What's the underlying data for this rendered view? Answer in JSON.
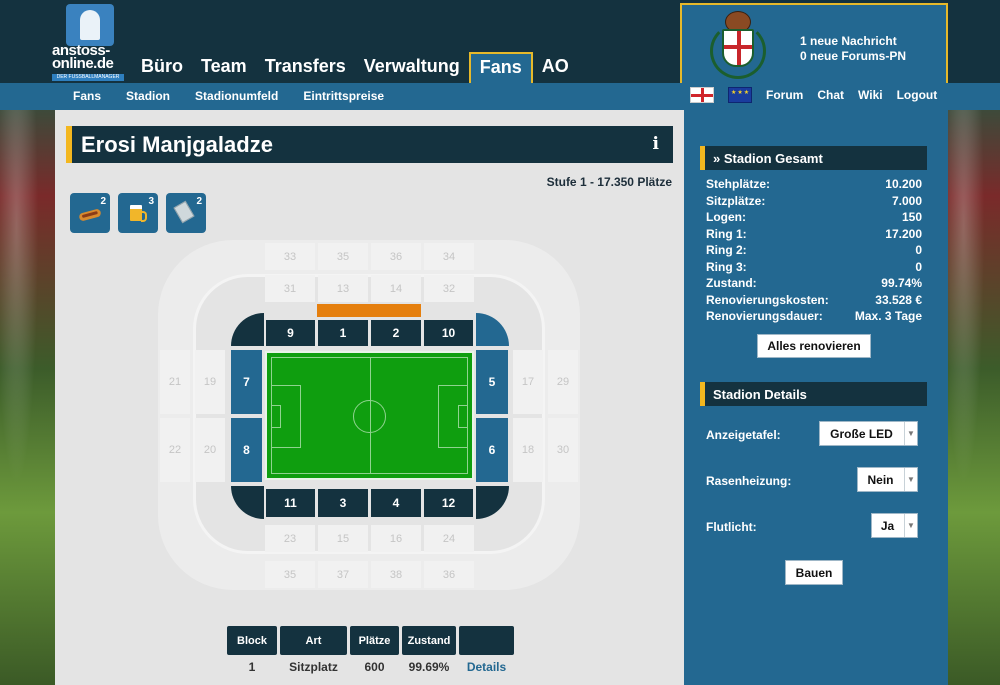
{
  "logo": {
    "text": "anstoss-online.de",
    "line1": "anstoss-",
    "line2": "online.de",
    "tagline": "DER FUSSBALLMANAGER"
  },
  "main_nav": [
    {
      "label": "Büro",
      "active": false
    },
    {
      "label": "Team",
      "active": false
    },
    {
      "label": "Transfers",
      "active": false
    },
    {
      "label": "Verwaltung",
      "active": false
    },
    {
      "label": "Fans",
      "active": true
    },
    {
      "label": "AO",
      "active": false
    }
  ],
  "user": {
    "messages": "1 neue Nachricht",
    "forum_pm": "0 neue Forums-PN"
  },
  "sub_nav": [
    "Fans",
    "Stadion",
    "Stadionumfeld",
    "Eintrittspreise"
  ],
  "right_nav": [
    "Forum",
    "Chat",
    "Wiki",
    "Logout"
  ],
  "page": {
    "title": "Erosi Manjgaladze",
    "info_icon": "i",
    "stufe": "Stufe 1 - 17.350 Plätze"
  },
  "items": [
    {
      "icon": "hotdog-icon",
      "count": "2"
    },
    {
      "icon": "beer-icon",
      "count": "3"
    },
    {
      "icon": "scarf-icon",
      "count": "2"
    }
  ],
  "stadium": {
    "blocks": [
      "9",
      "1",
      "2",
      "10",
      "7",
      "8",
      "5",
      "6",
      "11",
      "3",
      "4",
      "12"
    ],
    "ghost_blocks": [
      "33",
      "35",
      "36",
      "34",
      "31",
      "13",
      "14",
      "32",
      "21",
      "19",
      "22",
      "20",
      "17",
      "29",
      "18",
      "30",
      "23",
      "15",
      "16",
      "24",
      "35",
      "37",
      "38",
      "36"
    ]
  },
  "table": {
    "headers": [
      "Block",
      "Art",
      "Plätze",
      "Zustand",
      ""
    ],
    "rows": [
      {
        "block": "1",
        "art": "Sitzplatz",
        "plaetze": "600",
        "zustand": "99.69%",
        "action": "Details"
      }
    ]
  },
  "sidebar": {
    "gesamt_title": "» Stadion Gesamt",
    "stats": [
      {
        "label": "Stehplätze:",
        "value": "10.200"
      },
      {
        "label": "Sitzplätze:",
        "value": "7.000"
      },
      {
        "label": "Logen:",
        "value": "150"
      },
      {
        "label": "Ring 1:",
        "value": "17.200"
      },
      {
        "label": "Ring 2:",
        "value": "0"
      },
      {
        "label": "Ring 3:",
        "value": "0"
      },
      {
        "label": "Zustand:",
        "value": "99.74%"
      },
      {
        "label": "Renovierungskosten:",
        "value": "33.528 €"
      },
      {
        "label": "Renovierungsdauer:",
        "value": "Max. 3 Tage"
      }
    ],
    "renovate_button": "Alles renovieren",
    "details_title": "Stadion Details",
    "details": [
      {
        "label": "Anzeigetafel:",
        "value": "Große LED"
      },
      {
        "label": "Rasenheizung:",
        "value": "Nein"
      },
      {
        "label": "Flutlicht:",
        "value": "Ja"
      }
    ],
    "build_button": "Bauen"
  },
  "colors": {
    "navy": "#14323f",
    "blue": "#236891",
    "accent": "#f3b71f",
    "pitch": "#0f9e0f",
    "scoreboard": "#e57f0e"
  }
}
